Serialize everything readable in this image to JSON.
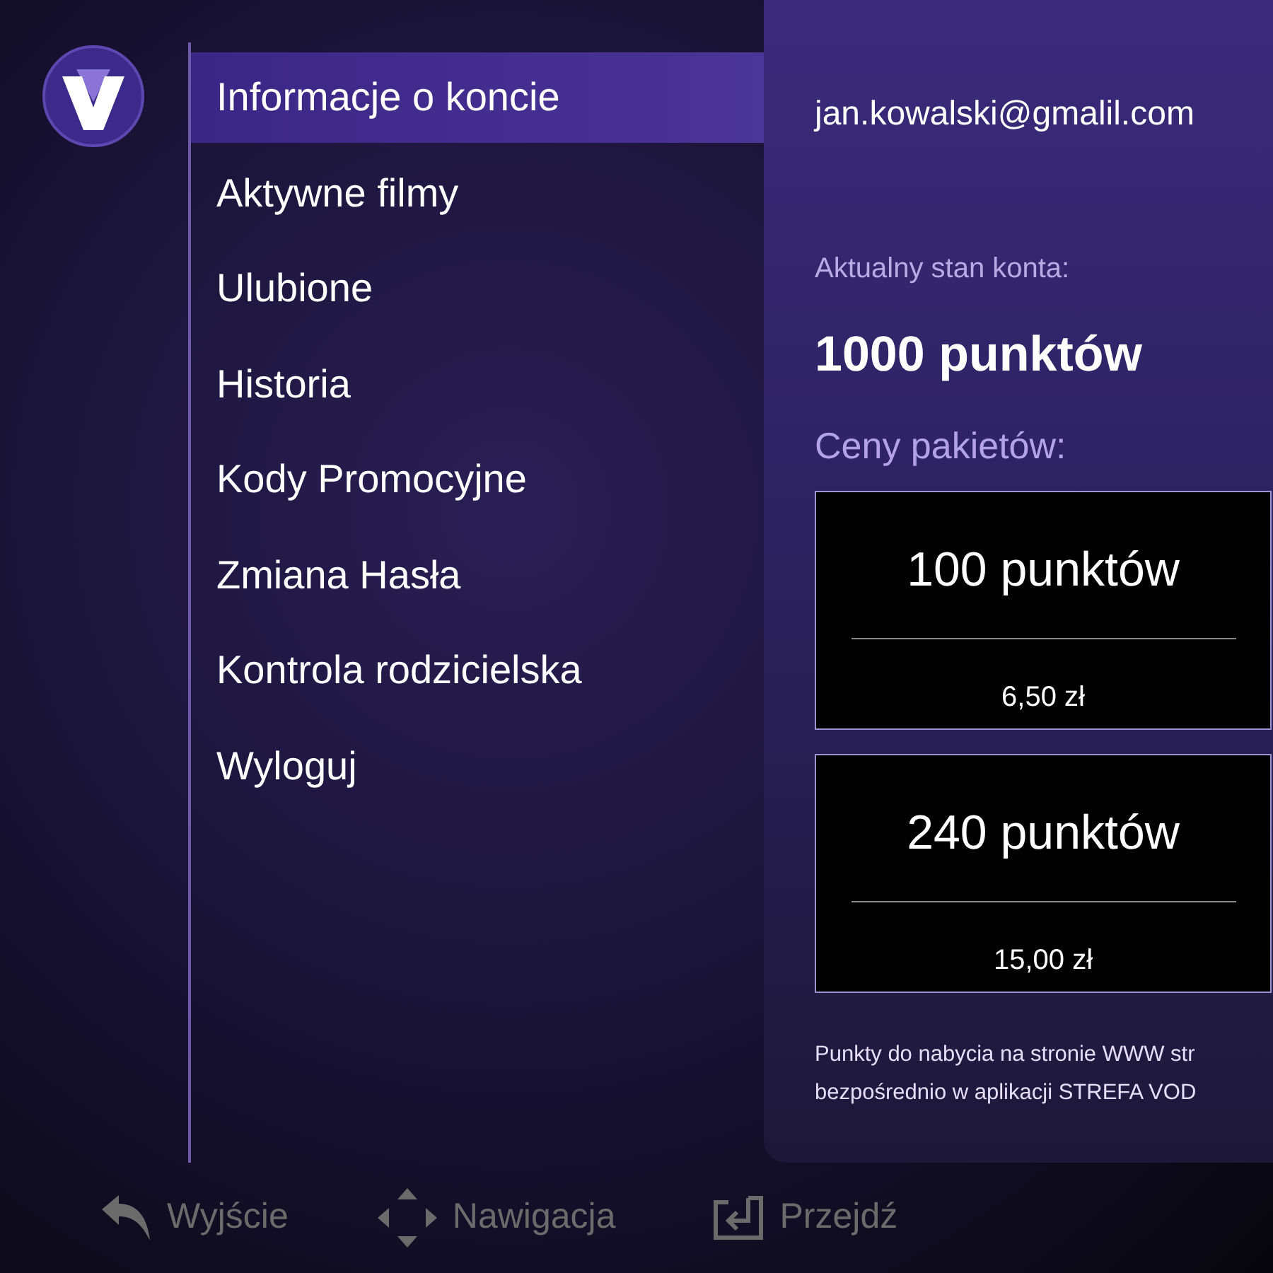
{
  "menu": [
    {
      "label": "Informacje o koncie",
      "selected": true
    },
    {
      "label": "Aktywne filmy",
      "selected": false
    },
    {
      "label": "Ulubione",
      "selected": false
    },
    {
      "label": "Historia",
      "selected": false
    },
    {
      "label": "Kody Promocyjne",
      "selected": false
    },
    {
      "label": "Zmiana Hasła",
      "selected": false
    },
    {
      "label": "Kontrola rodzicielska",
      "selected": false
    },
    {
      "label": "Wyloguj",
      "selected": false
    }
  ],
  "account": {
    "email": "jan.kowalski@gmalil.com",
    "balance_label": "Aktualny stan konta:",
    "balance": "1000 punktów",
    "packages_title": "Ceny pakietów:",
    "packages": [
      {
        "points": "100 punktów",
        "price": "6,50 zł"
      },
      {
        "points": "240 punktów",
        "price": "15,00 zł"
      }
    ],
    "note": "Punkty do nabycia na stronie WWW str\nbezpośrednio w aplikacji STREFA VOD"
  },
  "hints": [
    {
      "kind": "back",
      "label": "Wyjście"
    },
    {
      "kind": "dpad",
      "label": "Nawigacja"
    },
    {
      "kind": "enter",
      "label": "Przejdź"
    }
  ]
}
